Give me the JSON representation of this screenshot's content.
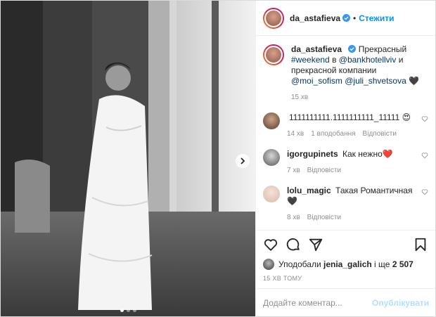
{
  "header": {
    "username": "da_astafieva",
    "separator": "•",
    "follow_label": "Стежити"
  },
  "caption": {
    "username": "da_astafieva",
    "text_1": "Прекрасный",
    "hashtag": "#weekend",
    "text_2": "в",
    "mention_1": "@bankhotellviv",
    "text_3": "и прекрасной компании",
    "mention_2": "@moi_sofism",
    "mention_3": "@juli_shvetsova",
    "emoji": "🖤",
    "time": "15 хв"
  },
  "comments": [
    {
      "username": "",
      "text": "1111111111.1111111111_11111 😍",
      "time": "14 хв",
      "likes": "1 вподобання",
      "reply": "Відповісти"
    },
    {
      "username": "igorgupinets",
      "text": "Как нежно❤️",
      "time": "7 хв",
      "reply": "Відповісти"
    },
    {
      "username": "lolu_magic",
      "text": "Такая Романтичная 🖤",
      "time": "8 хв",
      "reply": "Відповісти"
    }
  ],
  "likes": {
    "prefix": "Уподобали",
    "user": "jenia_galich",
    "middle": "і ще",
    "count": "2 507"
  },
  "post_time": "15 ХВ ТОМУ",
  "add_comment": {
    "placeholder": "Додайте коментар...",
    "publish_label": "Опублікувати"
  },
  "icons": {
    "like": "heart-icon",
    "comment": "comment-icon",
    "share": "share-icon",
    "save": "bookmark-icon",
    "verified": "verified-badge-icon",
    "next": "chevron-right-icon"
  },
  "colors": {
    "accent": "#0095f6",
    "link": "#00376b",
    "muted": "#8e8e8e",
    "publish_disabled": "#b2dffc"
  },
  "carousel": {
    "count": 3,
    "active": 0
  }
}
